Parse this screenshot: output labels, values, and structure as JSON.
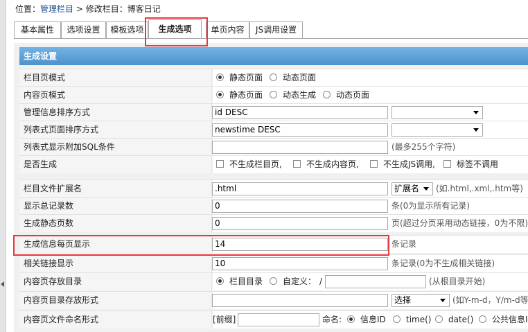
{
  "breadcrumb": {
    "prefix": "位置：",
    "link": "管理栏目",
    "sep": " > ",
    "current": "修改栏目：博客日记"
  },
  "tabs": [
    "基本属性",
    "选项设置",
    "模板选项",
    "生成选项",
    "单页内容",
    "JS调用设置"
  ],
  "panel_title": "生成设置",
  "rows": {
    "list_mode": {
      "label": "栏目页模式",
      "opt1": "静态页面",
      "opt2": "动态页面"
    },
    "content_mode": {
      "label": "内容页模式",
      "opt1": "静态页面",
      "opt2": "动态生成",
      "opt3": "动态页面"
    },
    "manage_sort": {
      "label": "管理信息排序方式",
      "value": "id DESC",
      "select": ""
    },
    "list_sort": {
      "label": "列表式页面排序方式",
      "value": "newstime DESC",
      "select": ""
    },
    "list_sql": {
      "label": "列表式显示附加SQL条件",
      "value": "",
      "hint": "(最多255个字符)"
    },
    "generate": {
      "label": "是否生成",
      "c1": "不生成栏目页,",
      "c2": "不生成内容页,",
      "c3": "不生成JS调用,",
      "c4": "标签不调用"
    },
    "ext": {
      "label": "栏目文件扩展名",
      "value": ".html",
      "select": "扩展名",
      "hint": "(如.html,.xml,.htm等)"
    },
    "total": {
      "label": "显示总记录数",
      "value": "0",
      "hint": "条(0为显示所有记录)"
    },
    "static_pages": {
      "label": "生成静态页数",
      "value": "0",
      "hint": "页(超过分页采用动态链接，0为不限)"
    },
    "per_page": {
      "label": "生成信息每页显示",
      "value": "14",
      "hint": "条记录"
    },
    "related": {
      "label": "相关链接显示",
      "value": "10",
      "hint": "条记录(0为不生成相关链接)"
    },
    "content_dir": {
      "label": "内容页存放目录",
      "opt1": "栏目目录",
      "opt2": "自定义：",
      "slash": "/",
      "value": "",
      "hint": "(从根目录开始)"
    },
    "dir_format": {
      "label": "内容页目录存放形式",
      "value": "",
      "select": "选择",
      "hint": "(如Y-m-d，Y/m-d等形式)"
    },
    "filename": {
      "label": "内容页文件命名形式",
      "prefix": "[前缀]",
      "value": "",
      "name_label": "命名:",
      "opt1": "信息ID",
      "opt2": "time()",
      "opt3": "date()",
      "opt4": "公共信息ID"
    }
  }
}
